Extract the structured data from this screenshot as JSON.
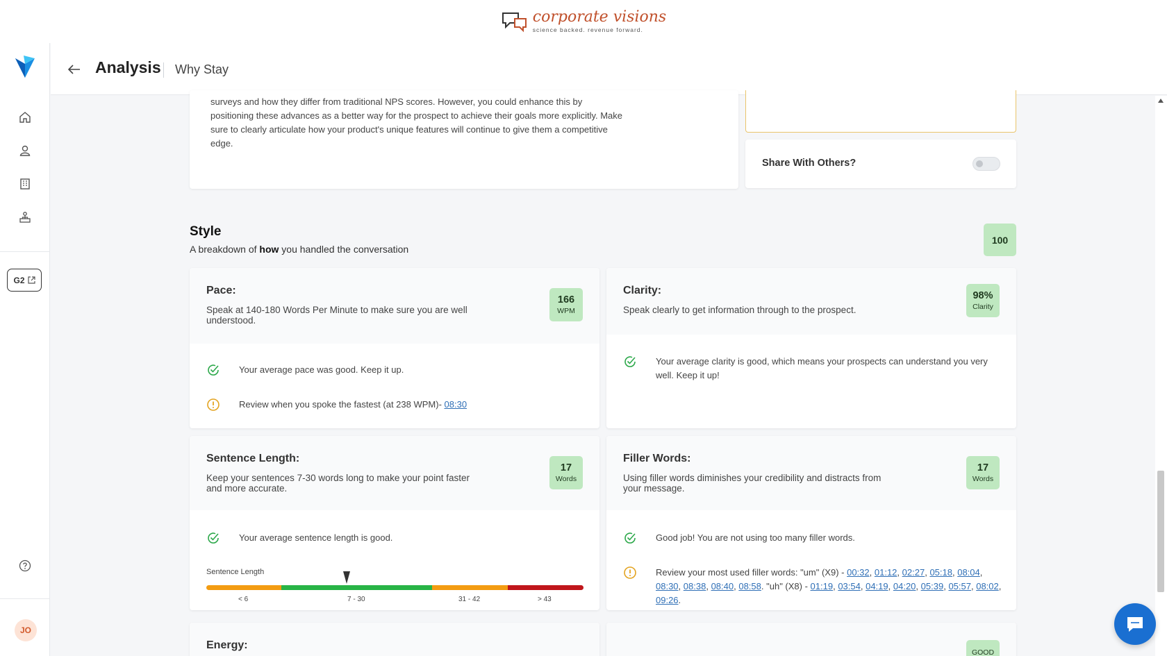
{
  "brand": {
    "name": "corporate visions",
    "tagline": "science backed. revenue forward."
  },
  "sidebar": {
    "items": [
      {
        "icon": "home-icon"
      },
      {
        "icon": "user-icon"
      },
      {
        "icon": "building-icon"
      },
      {
        "icon": "hierarchy-icon"
      }
    ],
    "g2_label": "G2",
    "help_icon": "help-icon",
    "avatar_initials": "JO"
  },
  "header": {
    "title": "Analysis",
    "subtitle": "Why Stay"
  },
  "feedback": {
    "text": "surveys and how they differ from traditional NPS scores. However, you could enhance this by positioning these advances as a better way for the prospect to achieve their goals more explicitly. Make sure to clearly articulate how your product's unique features will continue to give them a competitive edge."
  },
  "share": {
    "label": "Share With Others?",
    "enabled": false
  },
  "style": {
    "title": "Style",
    "subtitle_pre": "A breakdown of ",
    "subtitle_bold": "how",
    "subtitle_post": " you handled the conversation",
    "score": "100"
  },
  "pace": {
    "title": "Pace:",
    "desc": "Speak at 140-180 Words Per Minute to make sure you are well understood.",
    "value": "166",
    "unit": "WPM",
    "good_text": "Your average pace was good. Keep it up.",
    "warn_text": "Review when you spoke the fastest (at 238 WPM)- ",
    "warn_link": "08:30"
  },
  "clarity": {
    "title": "Clarity:",
    "desc": "Speak clearly to get information through to the prospect.",
    "value": "98%",
    "unit": "Clarity",
    "good_text": "Your average clarity is good, which means your prospects can understand you very well. Keep it up!"
  },
  "sentence": {
    "title": "Sentence Length:",
    "desc": "Keep your sentences 7-30 words long to make your point faster and more accurate.",
    "value": "17",
    "unit": "Words",
    "good_text": "Your average sentence length is good.",
    "scale_label": "Sentence Length",
    "scale_value": 17,
    "ticks": [
      "< 6",
      "7 - 30",
      "31 - 42",
      "> 43"
    ],
    "colors": {
      "orange": "#f39c12",
      "green": "#28b446",
      "red": "#c0161b"
    }
  },
  "filler": {
    "title": "Filler Words:",
    "desc": "Using filler words diminishes your credibility and distracts from your message.",
    "value": "17",
    "unit": "Words",
    "good_text": "Good job! You are not using too many filler words.",
    "review_prefix": "Review your most used filler words: \"um\" (X9) - ",
    "um_times": [
      "00:32",
      "01:12",
      "02:27",
      "05:18",
      "08:04",
      "08:30",
      "08:38",
      "08:40",
      "08:58"
    ],
    "uh_prefix": ". \"uh\" (X8) - ",
    "uh_times": [
      "01:19",
      "03:54",
      "04:19",
      "04:20",
      "05:39",
      "05:57",
      "08:02",
      "09:26"
    ]
  },
  "energy": {
    "title": "Energy:",
    "badge": "GOOD"
  },
  "colors": {
    "good_green": "#2ca84a",
    "warn_amber": "#e3a320",
    "badge_green": "#bfe8c0",
    "link": "#2f6fb6"
  }
}
